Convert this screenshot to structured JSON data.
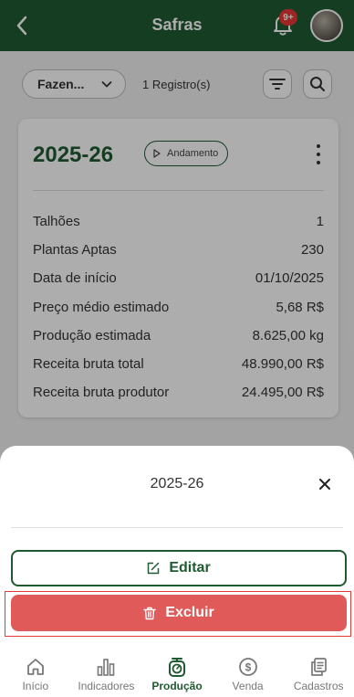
{
  "header": {
    "title": "Safras",
    "notification_badge": "9+"
  },
  "toolbar": {
    "farm_select_value": "Fazen...",
    "record_count": "1 Registro(s)"
  },
  "card": {
    "title": "2025-26",
    "status": "Andamento",
    "rows": [
      {
        "label": "Talhões",
        "value": "1"
      },
      {
        "label": "Plantas Aptas",
        "value": "230"
      },
      {
        "label": "Data de início",
        "value": "01/10/2025"
      },
      {
        "label": "Preço médio estimado",
        "value": "5,68 R$"
      },
      {
        "label": "Produção estimada",
        "value": "8.625,00 kg"
      },
      {
        "label": "Receita bruta total",
        "value": "48.990,00 R$"
      },
      {
        "label": "Receita bruta produtor",
        "value": "24.495,00 R$"
      }
    ]
  },
  "sheet": {
    "title": "2025-26",
    "edit_label": "Editar",
    "delete_label": "Excluir"
  },
  "nav": {
    "items": [
      {
        "label": "Início",
        "icon": "home-icon",
        "active": false
      },
      {
        "label": "Indicadores",
        "icon": "bar-chart-icon",
        "active": false
      },
      {
        "label": "Produção",
        "icon": "scale-icon",
        "active": true
      },
      {
        "label": "Venda",
        "icon": "dollar-coin-icon",
        "active": false
      },
      {
        "label": "Cadastros",
        "icon": "document-copy-icon",
        "active": false
      }
    ]
  },
  "colors": {
    "primary": "#1f5a31",
    "danger": "#e05a5a",
    "badge": "#e53935"
  }
}
